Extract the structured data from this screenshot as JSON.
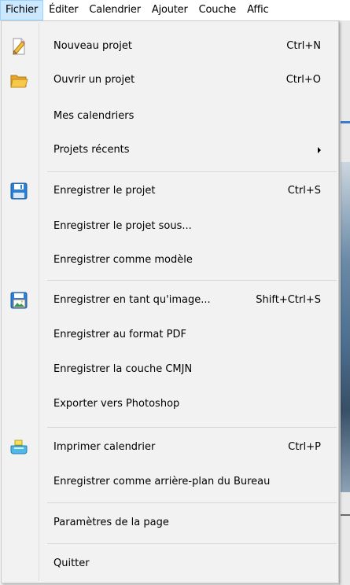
{
  "menubar": {
    "items": [
      "Fichier",
      "Éditer",
      "Calendrier",
      "Ajouter",
      "Couche",
      "Affic"
    ]
  },
  "menu": {
    "items": [
      {
        "label": "Nouveau projet",
        "shortcut": "Ctrl+N",
        "icon": "new-project-icon"
      },
      {
        "label": "Ouvrir un projet",
        "shortcut": "Ctrl+O",
        "icon": "folder-open-icon"
      },
      {
        "label": "Mes calendriers",
        "shortcut": ""
      },
      {
        "label": "Projets récents",
        "shortcut": "",
        "submenu": true
      },
      {
        "label": "Enregistrer le projet",
        "shortcut": "Ctrl+S",
        "icon": "floppy-save-icon"
      },
      {
        "label": "Enregistrer le projet sous...",
        "shortcut": ""
      },
      {
        "label": "Enregistrer comme modèle",
        "shortcut": ""
      },
      {
        "label": "Enregistrer en tant qu'image...",
        "shortcut": "Shift+Ctrl+S",
        "icon": "save-image-icon"
      },
      {
        "label": "Enregistrer au format PDF",
        "shortcut": ""
      },
      {
        "label": "Enregistrer la couche CMJN",
        "shortcut": ""
      },
      {
        "label": "Exporter vers Photoshop",
        "shortcut": ""
      },
      {
        "label": "Imprimer calendrier",
        "shortcut": "Ctrl+P",
        "icon": "printer-icon"
      },
      {
        "label": "Enregistrer comme arrière-plan du Bureau",
        "shortcut": ""
      },
      {
        "label": "Paramètres de la page",
        "shortcut": ""
      },
      {
        "label": "Quitter",
        "shortcut": ""
      }
    ]
  },
  "colors": {
    "menubar_active_bg": "#cce8ff",
    "menu_bg": "#f2f2f2",
    "separator": "#d7d7d7"
  }
}
